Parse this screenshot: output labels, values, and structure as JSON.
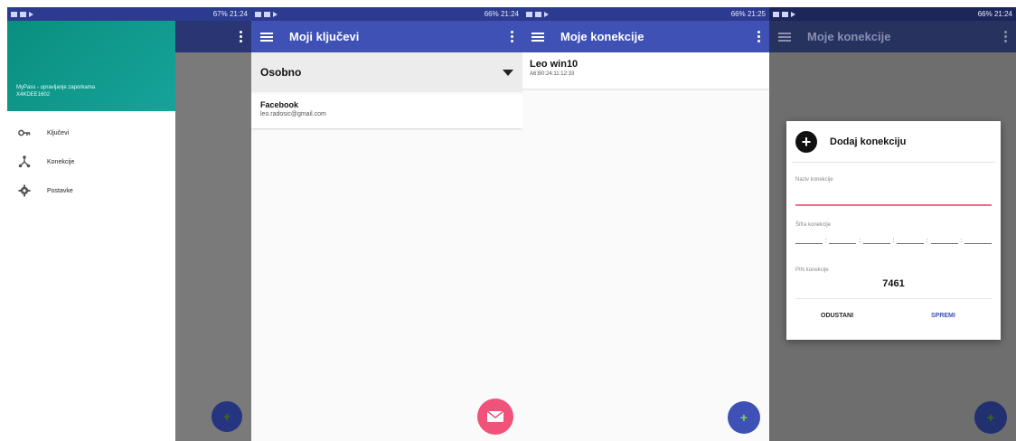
{
  "phone1": {
    "status": {
      "right": "67% 21:24",
      "bluetooth": "bluetooth-icon"
    },
    "drawer": {
      "title": "MyPass - upravljanje zaporkama",
      "subtitle": "X4KDEE1602",
      "items": [
        {
          "label": "Ključevi",
          "icon": "key-icon"
        },
        {
          "label": "Konekcije",
          "icon": "share-nodes-icon"
        },
        {
          "label": "Postavke",
          "icon": "gear-icon"
        }
      ]
    },
    "fab": {
      "glyph": "+"
    }
  },
  "phone2": {
    "status": {
      "right": "66% 21:24"
    },
    "title": "Moji ključevi",
    "dropdown": {
      "value": "Osobno"
    },
    "entries": [
      {
        "title": "Facebook",
        "subtitle": "leo.radosic@gmail.com"
      }
    ],
    "fab": {
      "icon": "mail-icon",
      "color": "#f0527a"
    }
  },
  "phone3": {
    "status": {
      "right": "66% 21:25"
    },
    "title": "Moje konekcije",
    "connections": [
      {
        "name": "Leo win10",
        "address": "A6:B0:24:11:12:33"
      }
    ],
    "fab": {
      "glyph": "+"
    }
  },
  "phone4": {
    "status": {
      "right": "66% 21:24"
    },
    "title": "Moje konekcije",
    "dialog": {
      "title": "Dodaj konekciju",
      "name_label": "Naziv konekcije",
      "code_label": "Šifra konekcije",
      "pin_label": "PIN konekcije",
      "pin_value": "7461",
      "cancel": "ODUSTANI",
      "save": "SPREMI"
    },
    "fab": {
      "glyph": "+"
    }
  },
  "colors": {
    "primary": "#3f51b5",
    "drawer_header": "#0a8f7f",
    "accent": "#f06a8a",
    "statusbar": "#2c3a8f"
  }
}
